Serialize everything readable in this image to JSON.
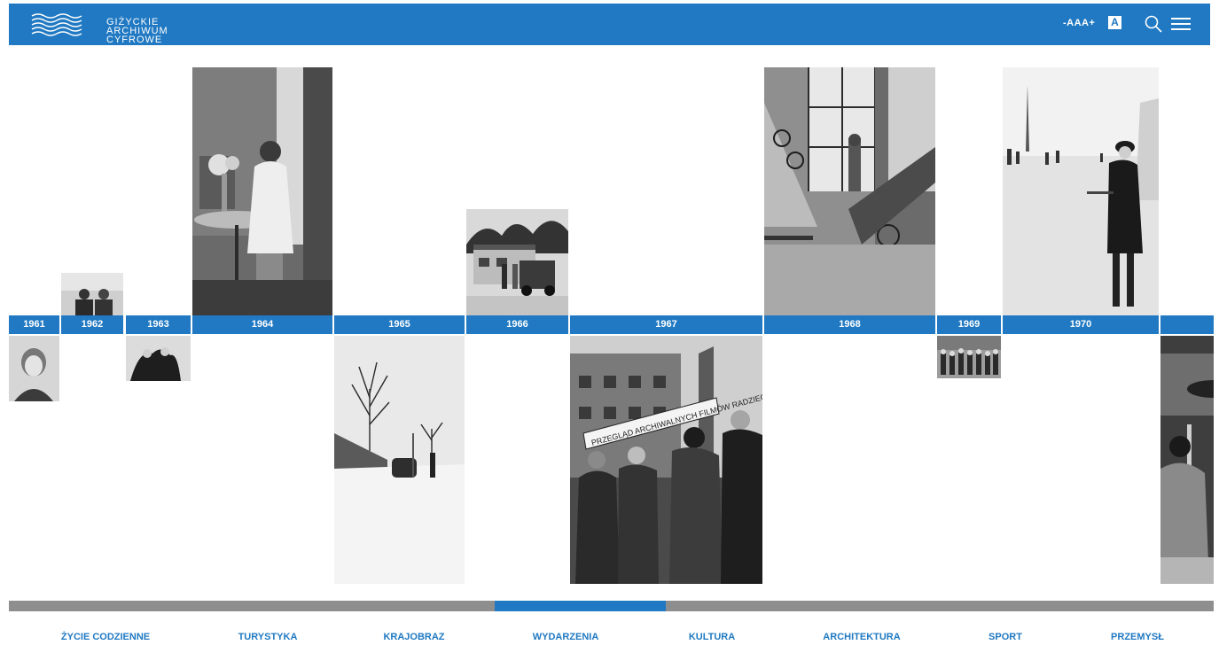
{
  "header": {
    "logo_lines": [
      "GIŻYCKIE",
      "ARCHIWUM",
      "CYFROWE"
    ],
    "font_size_control": "-AAA+",
    "contrast_label": "A",
    "search_icon": "magnifier-icon",
    "menu_icon": "hamburger-icon",
    "color": "#2079c2"
  },
  "timeline": {
    "years": [
      "1961",
      "1962",
      "1963",
      "1964",
      "1965",
      "1966",
      "1967",
      "1968",
      "1969",
      "1970"
    ],
    "photos": [
      {
        "year": "1961",
        "subject": "girl-portrait"
      },
      {
        "year": "1962",
        "subject": "two-people"
      },
      {
        "year": "1963",
        "subject": "group-dark-coats"
      },
      {
        "year": "1964",
        "subject": "woman-at-table"
      },
      {
        "year": "1965",
        "subject": "snowy-road-car"
      },
      {
        "year": "1966",
        "subject": "building-with-vehicle"
      },
      {
        "year": "1967",
        "subject": "street-banner-crowd"
      },
      {
        "year": "1968",
        "subject": "staircase-interior"
      },
      {
        "year": "1969",
        "subject": "crowd-group"
      },
      {
        "year": "1970",
        "subject": "woman-on-ice"
      },
      {
        "year": "",
        "subject": "bus-interior-partial"
      }
    ],
    "banner_text": "PRZEGLĄD ARCHIWALNYCH FILMÓW RADZIECKICH"
  },
  "progress": {
    "position_fraction": 0.4,
    "accent": "#2079c2",
    "track_color": "#8e8e8e"
  },
  "categories": [
    "ŻYCIE CODZIENNE",
    "TURYSTYKA",
    "KRAJOBRAZ",
    "WYDARZENIA",
    "KULTURA",
    "ARCHITEKTURA",
    "SPORT",
    "PRZEMYSŁ"
  ]
}
